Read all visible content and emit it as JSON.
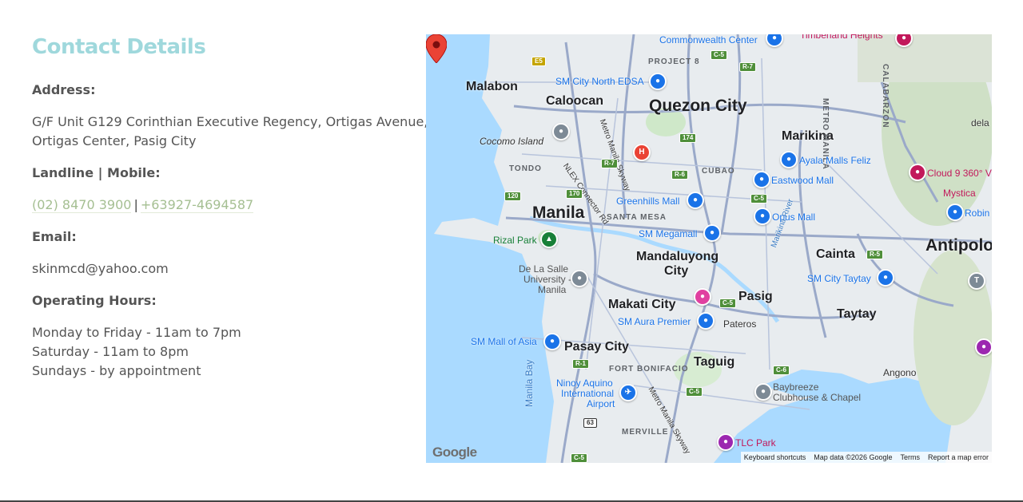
{
  "contact": {
    "title": "Contact Details",
    "address_label": "Address:",
    "address_line1": "G/F Unit G129 Corinthian Executive Regency, Ortigas Avenue,",
    "address_line2": "Ortigas Center, Pasig City",
    "phone_label": "Landline | Mobile:",
    "landline": "(02) 8470 3900",
    "phone_sep": "|",
    "mobile": "+63927-4694587",
    "email_label": "Email:",
    "email": "skinmcd@yahoo.com",
    "hours_label": "Operating Hours:",
    "hours": [
      "Monday to Friday - 11am to 7pm",
      "Saturday - 11am to 8pm",
      "Sundays - by appointment"
    ]
  },
  "map": {
    "cities": {
      "quezon": "Quezon City",
      "manila": "Manila",
      "mandaluyong_1": "Mandaluyong",
      "mandaluyong_2": "City",
      "makati": "Makati City",
      "pasay": "Pasay City",
      "pasig": "Pasig",
      "taguig": "Taguig",
      "antipolo": "Antipolo",
      "caloocan": "Caloocan",
      "malabon": "Malabon",
      "marikina": "Marikina",
      "cainta": "Cainta",
      "taytay": "Taytay",
      "angono": "Angono",
      "pateros": "Pateros",
      "cocomo": "Cocomo Island"
    },
    "areas": {
      "project8": "PROJECT 8",
      "tondo": "TONDO",
      "cubao": "CUBAO",
      "santa_mesa": "SANTA MESA",
      "fort_bonifacio": "FORT BONIFACIO",
      "merville": "MERVILLE",
      "metro_manila": "METRO MANILA",
      "calabarzon": "CALABARZON",
      "manila_bay": "Manila Bay",
      "dela": "dela"
    },
    "pois": {
      "commonwealth": "Commonwealth Center",
      "sm_north": "SM City North EDSA",
      "ayala_feliz": "Ayala Malls Feliz",
      "cloud9": "Cloud 9 360° V",
      "eastwood": "Eastwood Mall",
      "mystica": "Mystica",
      "robins": "Robin",
      "greenhills": "Greenhills Mall",
      "opus": "Opus Mall",
      "megamall": "SM Megamall",
      "rizal_park": "Rizal Park",
      "dlsu_1": "De La Salle",
      "dlsu_2": "University -",
      "dlsu_3": "Manila",
      "sm_taytay": "SM City Taytay",
      "sm_aura": "SM Aura Premier",
      "moa": "SM Mall of Asia",
      "naia_1": "Ninoy Aquino",
      "naia_2": "International",
      "naia_3": "Airport",
      "baybreeze_1": "Baybreeze",
      "baybreeze_2": "Clubhouse & Chapel",
      "tlc": "TLC Park",
      "timberland": "Timberland Heights",
      "connector": "NLEX Connector Rd",
      "skyway": "Metro Manila Skyway",
      "marikina_river": "Marikina River"
    },
    "shields": [
      "E5",
      "C-5",
      "R-7",
      "174",
      "R-7",
      "R-6",
      "C-5",
      "120",
      "170",
      "R-5",
      "C-5",
      "R-1",
      "C-6",
      "C-5",
      "63",
      "C-5"
    ],
    "footer": {
      "shortcuts": "Keyboard shortcuts",
      "data": "Map data ©2026 Google",
      "terms": "Terms",
      "report": "Report a map error"
    },
    "google_logo": "Google",
    "colors": {
      "water": "#aadaff",
      "land": "#e8ecef",
      "road": "#9aa9c9",
      "green": "#cfe8c9",
      "pin": "#ea4335"
    }
  }
}
